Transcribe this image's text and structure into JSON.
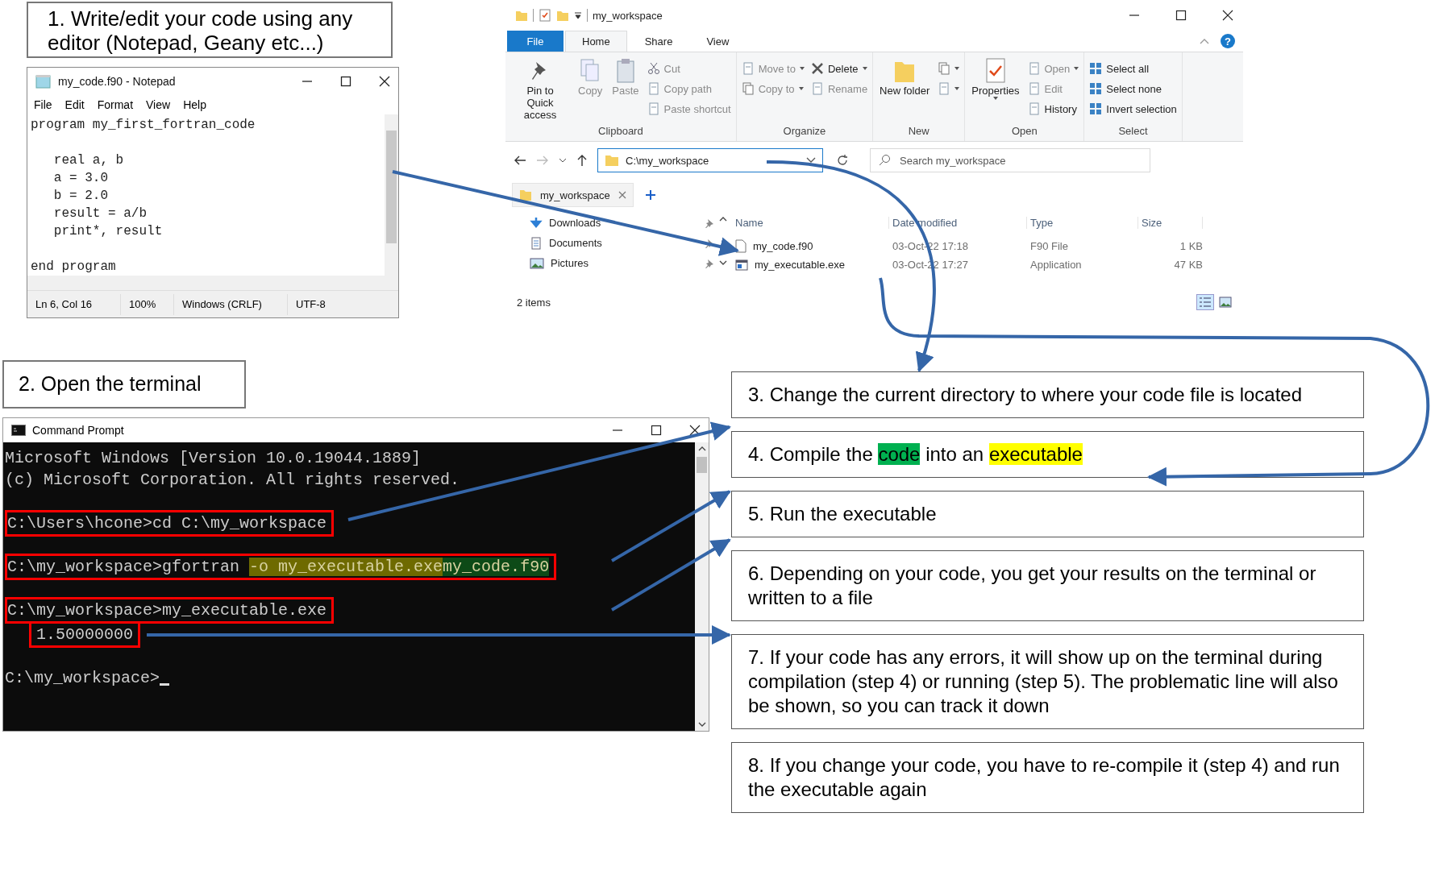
{
  "step_1": "1. Write/edit your code using any editor (Notepad, Geany etc...)",
  "notepad": {
    "title": "my_code.f90 - Notepad",
    "menu": [
      "File",
      "Edit",
      "Format",
      "View",
      "Help"
    ],
    "code": "program my_first_fortran_code\n\n   real a, b\n   a = 3.0\n   b = 2.0\n   result = a/b\n   print*, result\n\nend program",
    "status": [
      "Ln 6, Col 16",
      "100%",
      "Windows (CRLF)",
      "UTF-8"
    ]
  },
  "explorer": {
    "title": "my_workspace",
    "file_tab": "File",
    "tabs": [
      {
        "label": "Home",
        "selected": true
      },
      {
        "label": "Share",
        "selected": false
      },
      {
        "label": "View",
        "selected": false
      }
    ],
    "help": "?",
    "groups": [
      {
        "label": "Clipboard",
        "buttons": [
          {
            "kind": "large",
            "label": "Pin to Quick access",
            "disabled": false,
            "dropdown": false
          },
          {
            "kind": "large",
            "label": "Copy",
            "disabled": true,
            "dropdown": false
          },
          {
            "kind": "large",
            "label": "Paste",
            "disabled": true,
            "dropdown": false
          },
          {
            "kind": "small",
            "label": "Cut",
            "disabled": true,
            "dropdown": false
          },
          {
            "kind": "small",
            "label": "Copy path",
            "disabled": true,
            "dropdown": false
          },
          {
            "kind": "small",
            "label": "Paste shortcut",
            "disabled": true,
            "dropdown": false
          }
        ]
      },
      {
        "label": "Organize",
        "buttons": [
          {
            "kind": "small",
            "label": "Move to",
            "disabled": true,
            "dropdown": true
          },
          {
            "kind": "small",
            "label": "Copy to",
            "disabled": true,
            "dropdown": true
          },
          {
            "kind": "small",
            "label": "Delete",
            "disabled": false,
            "dropdown": true
          },
          {
            "kind": "small",
            "label": "Rename",
            "disabled": true,
            "dropdown": false
          }
        ]
      },
      {
        "label": "New",
        "buttons": [
          {
            "kind": "large",
            "label": "New folder",
            "disabled": false,
            "dropdown": false
          },
          {
            "kind": "icon",
            "disabled": false,
            "dropdown": true
          },
          {
            "kind": "icon",
            "disabled": false,
            "dropdown": true
          }
        ]
      },
      {
        "label": "Open",
        "buttons": [
          {
            "kind": "large",
            "label": "Properties",
            "disabled": false,
            "dropdown": true
          },
          {
            "kind": "small",
            "label": "Open",
            "disabled": true,
            "dropdown": true
          },
          {
            "kind": "small",
            "label": "Edit",
            "disabled": true,
            "dropdown": false
          },
          {
            "kind": "small",
            "label": "History",
            "disabled": false,
            "dropdown": false
          }
        ]
      },
      {
        "label": "Select",
        "buttons": [
          {
            "kind": "small",
            "label": "Select all",
            "disabled": false,
            "dropdown": false
          },
          {
            "kind": "small",
            "label": "Select none",
            "disabled": false,
            "dropdown": false
          },
          {
            "kind": "small",
            "label": "Invert selection",
            "disabled": false,
            "dropdown": false
          }
        ]
      }
    ],
    "path": "C:\\my_workspace",
    "search_placeholder": "Search my_workspace",
    "folder_tab": "my_workspace",
    "nav_items": [
      "Downloads",
      "Documents",
      "Pictures"
    ],
    "columns": [
      "Name",
      "Date modified",
      "Type",
      "Size"
    ],
    "files": [
      {
        "name": "my_code.f90",
        "modified": "03-Oct-22 17:18",
        "type": "F90 File",
        "size": "1 KB",
        "kind": "text"
      },
      {
        "name": "my_executable.exe",
        "modified": "03-Oct-22 17:27",
        "type": "Application",
        "size": "47 KB",
        "kind": "app"
      }
    ],
    "status": "2 items"
  },
  "step_2": "2. Open the terminal",
  "terminal": {
    "title": "Command Prompt",
    "lines": [
      {
        "kind": "text",
        "segments": [
          {
            "text": "Microsoft Windows [Version 10.0.19044.1889]"
          }
        ],
        "boxed": false,
        "indented": false,
        "cursor": false
      },
      {
        "kind": "text",
        "segments": [
          {
            "text": "(c) Microsoft Corporation. All rights reserved."
          }
        ],
        "boxed": false,
        "indented": false,
        "cursor": false
      },
      {
        "kind": "blank"
      },
      {
        "kind": "text",
        "segments": [
          {
            "text": "C:\\Users\\hcone>cd C:\\my_workspace"
          }
        ],
        "boxed": true,
        "indented": false,
        "cursor": false
      },
      {
        "kind": "blank"
      },
      {
        "kind": "text",
        "segments": [
          {
            "text": "C:\\my_workspace>gfortran "
          },
          {
            "text": "-o my_executable.exe",
            "color": "#6e6a00"
          },
          {
            "text": "my_code.f90",
            "color": "#0d4a17"
          }
        ],
        "boxed": true,
        "indented": false,
        "cursor": false
      },
      {
        "kind": "blank"
      },
      {
        "kind": "text",
        "segments": [
          {
            "text": "C:\\my_workspace>my_executable.exe"
          }
        ],
        "boxed": true,
        "indented": false,
        "cursor": false
      },
      {
        "kind": "text",
        "segments": [
          {
            "text": "1.50000000"
          }
        ],
        "boxed": true,
        "indented": true,
        "cursor": false
      },
      {
        "kind": "blank"
      },
      {
        "kind": "text",
        "segments": [
          {
            "text": "C:\\my_workspace>"
          }
        ],
        "boxed": false,
        "indented": false,
        "cursor": true
      }
    ]
  },
  "steps": [
    {
      "segments": [
        {
          "text": "3. Change the current directory to where your code file is located"
        }
      ]
    },
    {
      "segments": [
        {
          "text": "4. Compile the "
        },
        {
          "text": "code",
          "color": "#00b050"
        },
        {
          "text": " into an "
        },
        {
          "text": "executable",
          "color": "#ffff00"
        }
      ]
    },
    {
      "segments": [
        {
          "text": "5. Run the executable"
        }
      ]
    },
    {
      "segments": [
        {
          "text": "6. Depending on your code, you get your results on the terminal or written to a file"
        }
      ]
    },
    {
      "segments": [
        {
          "text": "7. If your code has any errors, it will show up on the terminal during compilation (step 4) or running (step 5). The problematic line will also be shown, so you can track it down"
        }
      ]
    },
    {
      "segments": [
        {
          "text": "8. If you change your code, you have to re-compile it (step 4) and run the executable again"
        }
      ]
    }
  ]
}
